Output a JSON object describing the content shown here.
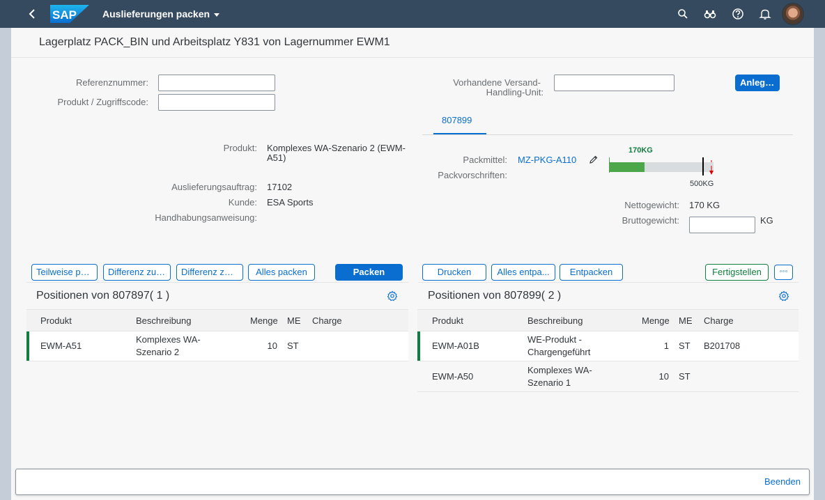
{
  "shell": {
    "app_title": "Auslieferungen packen",
    "logo_text": "SAP",
    "icons": [
      "back-icon",
      "search-icon",
      "binoculars-icon",
      "help-icon",
      "notification-bell-icon"
    ]
  },
  "header": {
    "title": "Lagerplatz PACK_BIN und Arbeitsplatz Y831 von Lagernummer EWM1"
  },
  "form_left": {
    "reference_label": "Referenznummer:",
    "reference_value": "",
    "product_code_label": "Produkt / Zugriffscode:",
    "product_code_value": "",
    "product_label": "Produkt:",
    "product_value_1": "Komplexes WA-Szenario 2 (EWM-",
    "product_value_2": "A51)",
    "delivery_label": "Auslieferungsauftrag:",
    "delivery_value": "17102",
    "customer_label": "Kunde:",
    "customer_value": "ESA Sports",
    "handling_label": "Handhabungsanweisung:"
  },
  "form_right": {
    "shipping_hu_label_1": "Vorhandene Versand-",
    "shipping_hu_label_2": "Handling-Unit:",
    "shipping_hu_value": "",
    "create_button": "Anlegen",
    "tab_label": "807899",
    "packmittel_label": "Packmittel:",
    "packmittel_value": "MZ-PKG-A110",
    "packvorschriften_label": "Packvorschriften:",
    "weight_current": "170KG",
    "weight_max": "500KG",
    "weight_fill_fraction": 0.34,
    "net_weight_label": "Nettogewicht:",
    "net_weight_value": "170 KG",
    "gross_weight_label": "Bruttogewicht:",
    "gross_weight_value": "",
    "gross_weight_unit": "KG"
  },
  "toolbar_left": {
    "partial_pack": "Teilweise pa...",
    "difference_1": "Differenz zu ...",
    "difference_2": "Differenz zu ...",
    "pack_all": "Alles packen",
    "pack": "Packen"
  },
  "toolbar_right": {
    "print": "Drucken",
    "unpack_all": "Alles entpa...",
    "unpack": "Entpacken",
    "complete": "Fertigstellen",
    "more": "◦◦◦"
  },
  "table_left": {
    "title": "Positionen von 807897( 1 )",
    "columns": [
      "Produkt",
      "Beschreibung",
      "Menge",
      "ME",
      "Charge"
    ],
    "rows": [
      {
        "product": "EWM-A51",
        "desc_1": "Komplexes WA-",
        "desc_2": "Szenario 2",
        "qty": "10",
        "unit": "ST",
        "batch": ""
      }
    ]
  },
  "table_right": {
    "title": "Positionen von 807899( 2 )",
    "columns": [
      "Produkt",
      "Beschreibung",
      "Menge",
      "ME",
      "Charge"
    ],
    "rows": [
      {
        "product": "EWM-A01B",
        "desc_1": "WE-Produkt -",
        "desc_2": "Chargengeführt",
        "qty": "1",
        "unit": "ST",
        "batch": "B201708"
      },
      {
        "product": "EWM-A50",
        "desc_1": "Komplexes WA-",
        "desc_2": "Szenario 1",
        "qty": "10",
        "unit": "ST",
        "batch": ""
      }
    ]
  },
  "footer": {
    "end_button": "Beenden"
  },
  "colors": {
    "shell": "#354a5f",
    "accent": "#0a6ed1",
    "positive": "#107e3e",
    "bar_fill": "#4ba74a"
  }
}
